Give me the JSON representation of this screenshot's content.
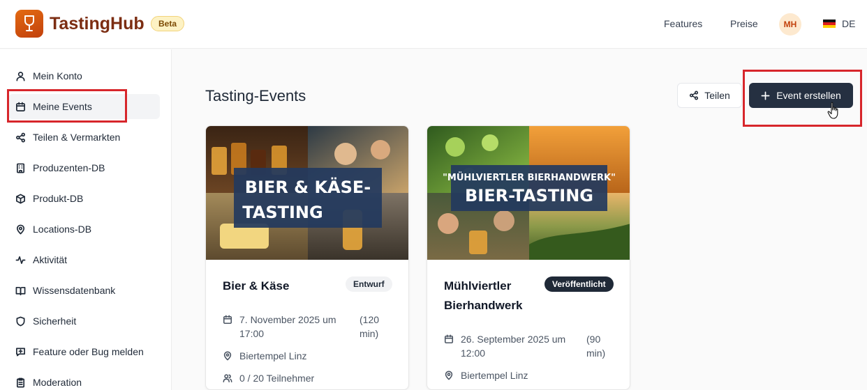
{
  "header": {
    "brand": "TastingHub",
    "beta_badge": "Beta",
    "nav": {
      "features": "Features",
      "pricing": "Preise"
    },
    "avatar_initials": "MH",
    "language": "DE"
  },
  "sidebar": {
    "items": [
      {
        "label": "Mein Konto",
        "icon": "user-icon"
      },
      {
        "label": "Meine Events",
        "icon": "calendar-icon",
        "active": true
      },
      {
        "label": "Teilen & Vermarkten",
        "icon": "share-icon"
      },
      {
        "label": "Produzenten-DB",
        "icon": "building-icon"
      },
      {
        "label": "Produkt-DB",
        "icon": "box-icon"
      },
      {
        "label": "Locations-DB",
        "icon": "map-pin-icon"
      },
      {
        "label": "Aktivität",
        "icon": "activity-icon"
      },
      {
        "label": "Wissensdatenbank",
        "icon": "book-icon"
      },
      {
        "label": "Sicherheit",
        "icon": "shield-icon"
      },
      {
        "label": "Feature oder Bug melden",
        "icon": "message-plus-icon"
      },
      {
        "label": "Moderation",
        "icon": "clipboard-icon"
      }
    ]
  },
  "main": {
    "title": "Tasting-Events",
    "share_label": "Teilen",
    "create_label": "Event erstellen",
    "events": [
      {
        "banner_line1": "BIER & KÄSE-",
        "banner_line2": "TASTING",
        "title": "Bier & Käse",
        "status": "Entwurf",
        "date_line1": "7. November 2025 um",
        "date_line2": "17:00",
        "duration_line1": "(120",
        "duration_line2": "min)",
        "location": "Biertempel Linz",
        "participants": "0 / 20 Teilnehmer"
      },
      {
        "banner_line1": "\"MÜHLVIERTLER BIERHANDWERK\"",
        "banner_line2": "BIER-TASTING",
        "title_line1": "Mühlviertler",
        "title_line2": "Bierhandwerk",
        "status": "Veröffentlicht",
        "date_line1": "26. September 2025 um",
        "date_line2": "12:00",
        "duration_line1": "(90",
        "duration_line2": "min)",
        "location": "Biertempel Linz"
      }
    ]
  },
  "colors": {
    "brand": "#c2410c",
    "primary_button": "#253041",
    "highlight": "#d7262b"
  }
}
